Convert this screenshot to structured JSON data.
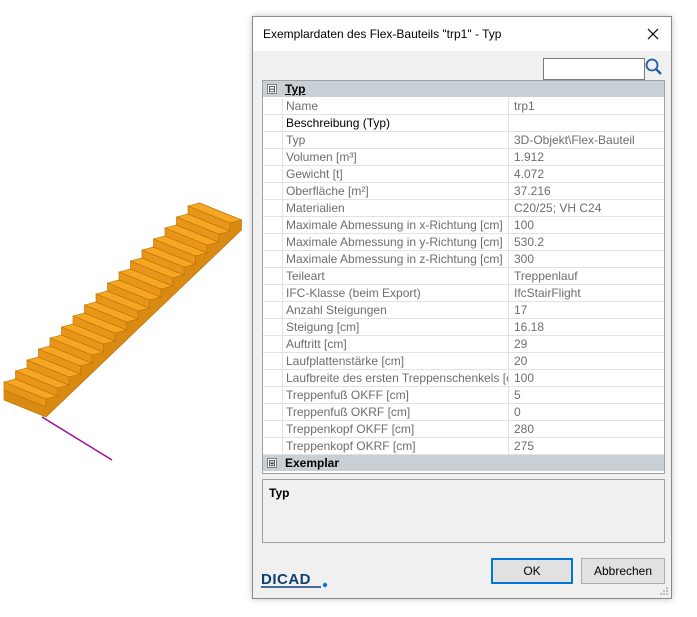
{
  "dialog": {
    "title": "Exemplardaten des Flex-Bauteils \"trp1\" - Typ",
    "close_icon": "close-icon"
  },
  "search": {
    "value": "",
    "placeholder": "",
    "icon": "search-icon"
  },
  "sections": [
    {
      "label": "Typ",
      "expanded": true,
      "toggle": "⊟"
    },
    {
      "label": "Exemplar",
      "expanded": false,
      "toggle": "⊞"
    }
  ],
  "properties": [
    {
      "name": "Name",
      "value": "trp1"
    },
    {
      "name": "Beschreibung (Typ)",
      "value": ""
    },
    {
      "name": "Typ",
      "value": "3D-Objekt\\Flex-Bauteil"
    },
    {
      "name": "Volumen [m³]",
      "value": "1.912"
    },
    {
      "name": "Gewicht [t]",
      "value": "4.072"
    },
    {
      "name": "Oberfläche [m²]",
      "value": "37.216"
    },
    {
      "name": "Materialien",
      "value": "C20/25; VH C24"
    },
    {
      "name": "Maximale Abmessung in x-Richtung [cm]",
      "value": "100"
    },
    {
      "name": "Maximale Abmessung in y-Richtung [cm]",
      "value": "530.2"
    },
    {
      "name": "Maximale Abmessung in z-Richtung [cm]",
      "value": "300"
    },
    {
      "name": "Teileart",
      "value": "Treppenlauf"
    },
    {
      "name": "IFC-Klasse (beim Export)",
      "value": "IfcStairFlight"
    },
    {
      "name": "Anzahl Steigungen",
      "value": "17"
    },
    {
      "name": "Steigung [cm]",
      "value": "16.18"
    },
    {
      "name": "Auftritt [cm]",
      "value": "29"
    },
    {
      "name": "Laufplattenstärke [cm]",
      "value": "20"
    },
    {
      "name": "Laufbreite des ersten Treppenschenkels [cm]",
      "value": "100"
    },
    {
      "name": "Treppenfuß OKFF [cm]",
      "value": "5"
    },
    {
      "name": "Treppenfuß OKRF [cm]",
      "value": "0"
    },
    {
      "name": "Treppenkopf OKFF [cm]",
      "value": "280"
    },
    {
      "name": "Treppenkopf OKRF [cm]",
      "value": "275"
    }
  ],
  "description": {
    "title": "Typ"
  },
  "logo": {
    "text": "DICAD"
  },
  "buttons": {
    "ok": "OK",
    "cancel": "Abbrechen"
  },
  "colors": {
    "stair": "#f5a623",
    "stair_edge": "#b86e00",
    "axis": "#a0109a",
    "accent": "#0078d7"
  }
}
